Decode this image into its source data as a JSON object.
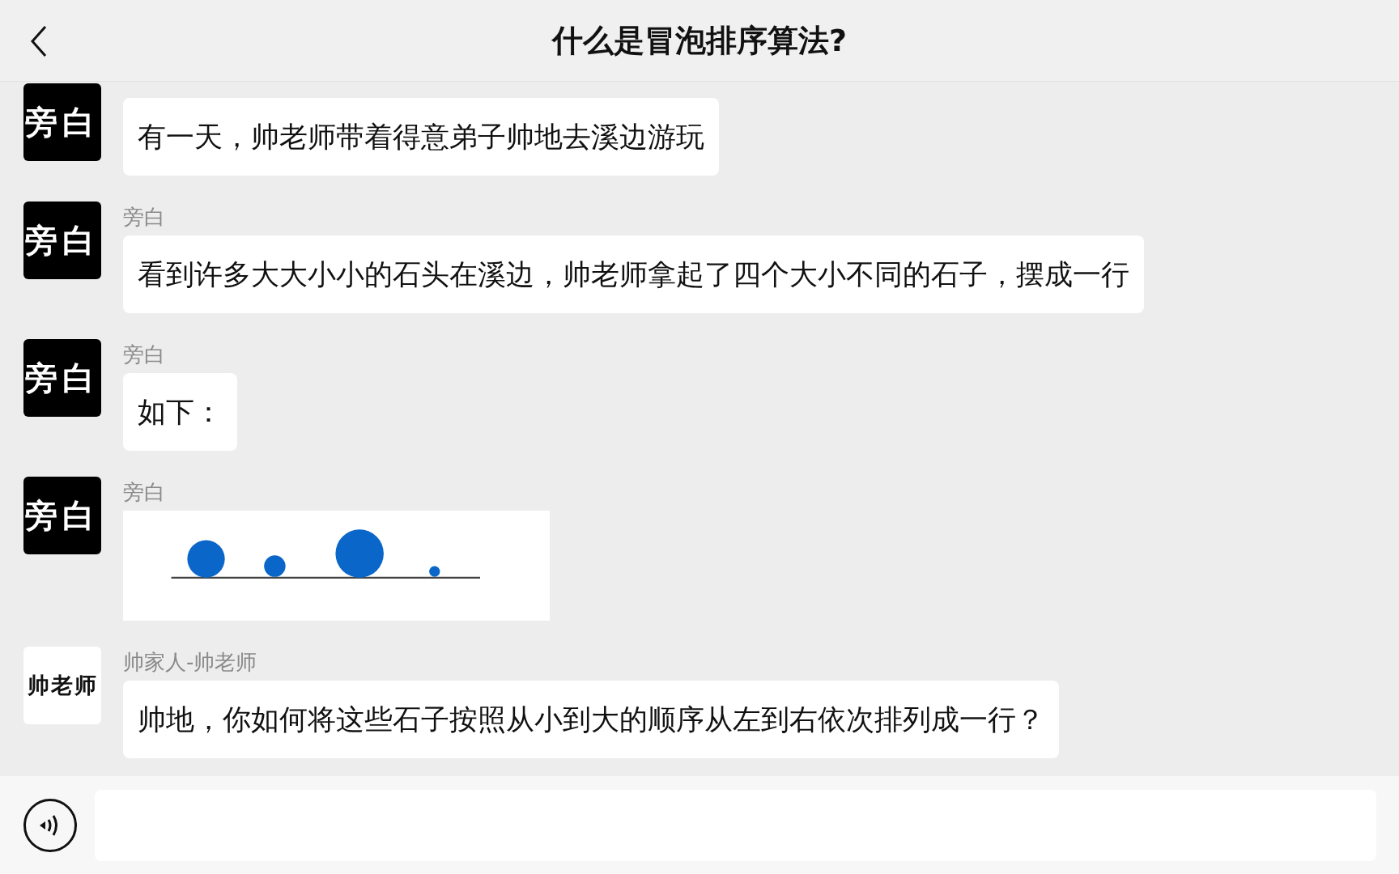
{
  "header": {
    "title": "什么是冒泡排序算法?"
  },
  "messages": [
    {
      "kind": "text",
      "avatar": {
        "text": "旁白",
        "color": "#000000"
      },
      "text": "有一天，帅老师带着得意弟子帅地去溪边游玩"
    },
    {
      "kind": "text",
      "sender": "旁白",
      "avatar": {
        "text": "旁白",
        "color": "#000000"
      },
      "text": "看到许多大大小小的石头在溪边，帅老师拿起了四个大小不同的石子，摆成一行"
    },
    {
      "kind": "text",
      "sender": "旁白",
      "avatar": {
        "text": "旁白",
        "color": "#000000"
      },
      "text": "如下："
    },
    {
      "kind": "image",
      "sender": "旁白",
      "avatar": {
        "text": "旁白",
        "color": "#000000"
      }
    },
    {
      "kind": "text",
      "sender": "帅家人-帅老师",
      "avatar": {
        "text": "帅老师",
        "color": "#ffffff"
      },
      "text": "帅地，你如何将这些石子按照从小到大的顺序从左到右依次排列成一行？"
    }
  ]
}
